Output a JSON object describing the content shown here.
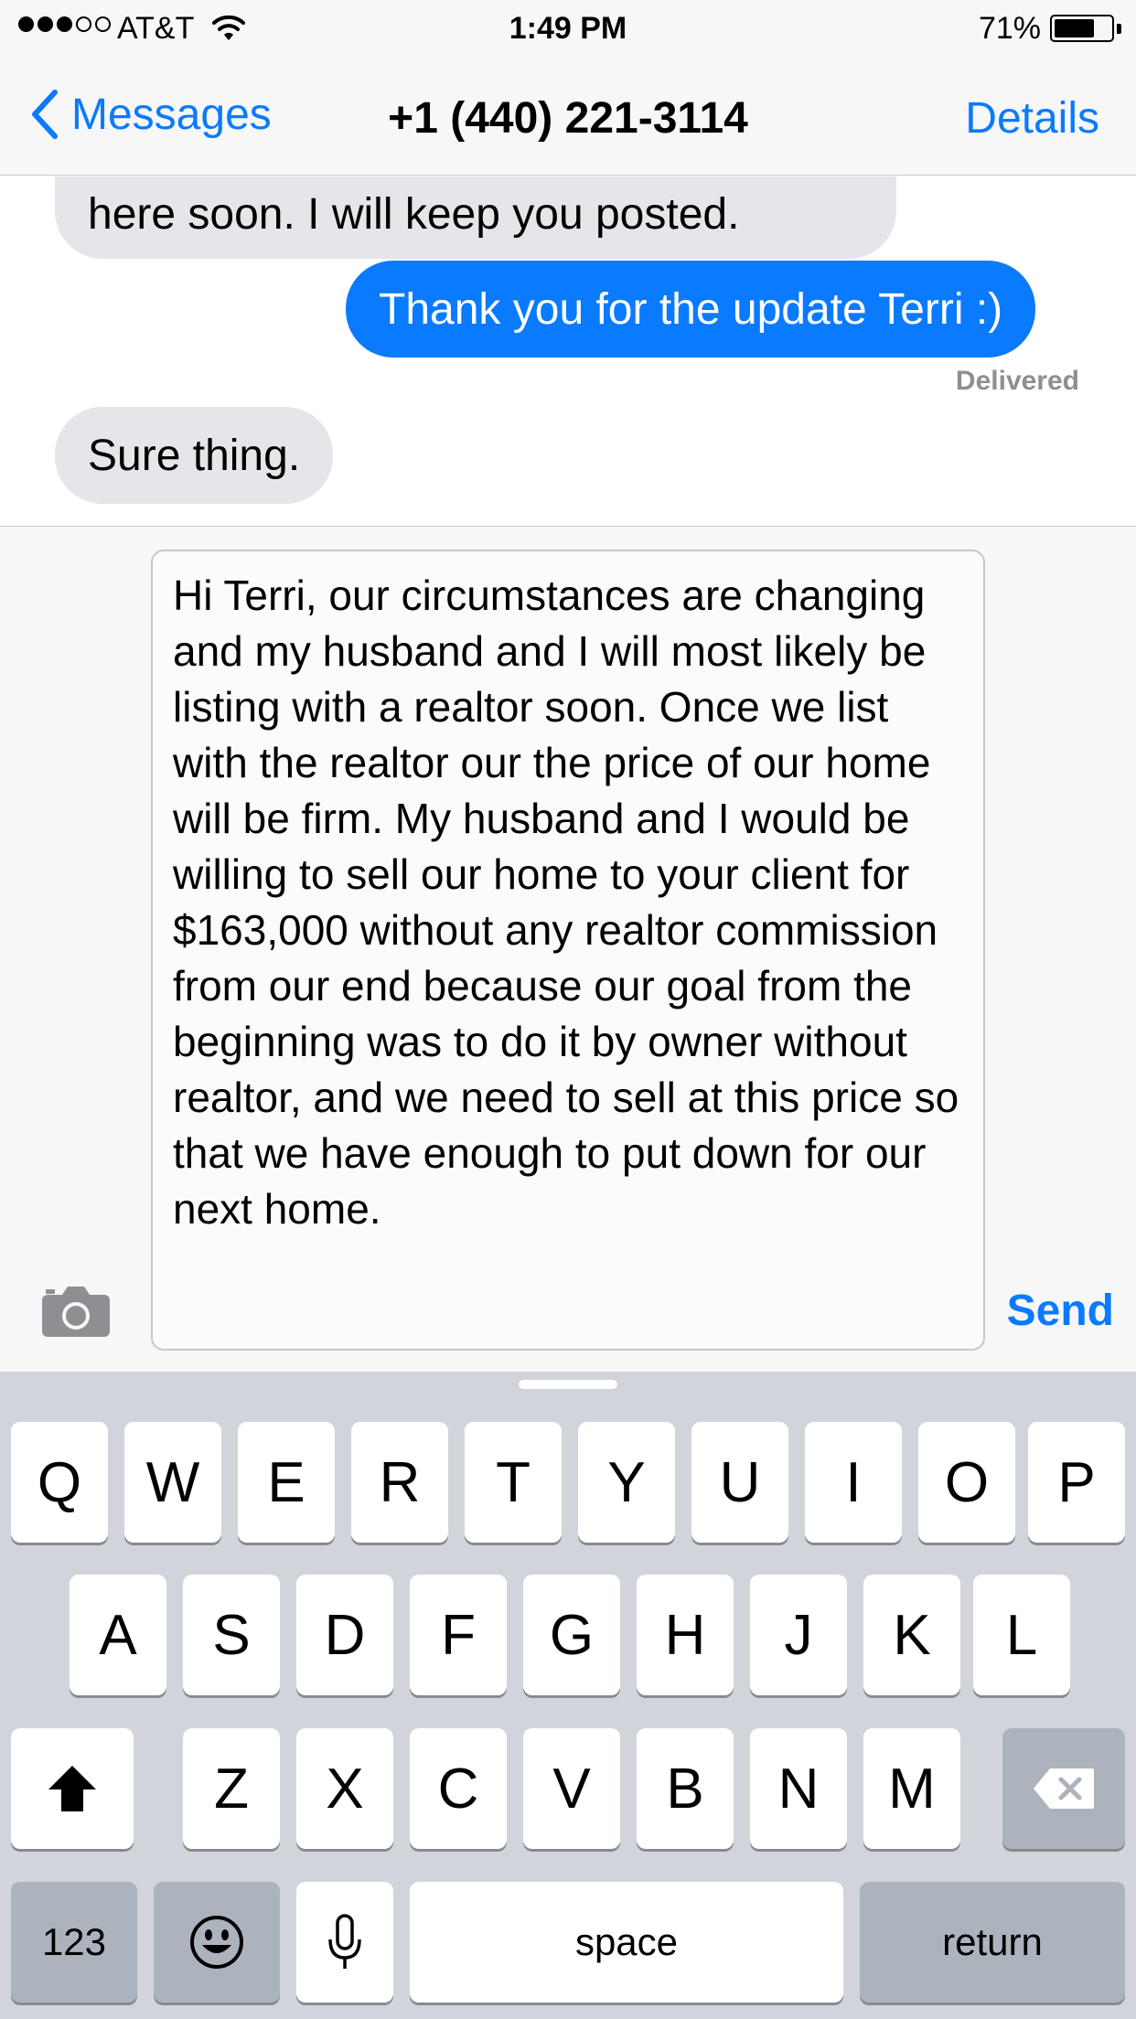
{
  "status_bar": {
    "signal_dots": 5,
    "signal_filled": 3,
    "carrier": "AT&T",
    "time": "1:49 PM",
    "battery_percent_label": "71%",
    "battery_level": 0.71
  },
  "nav": {
    "back_label": "Messages",
    "title": "+1 (440) 221-3114",
    "details_label": "Details"
  },
  "messages": [
    {
      "direction": "incoming",
      "text": "here soon. I will keep you posted."
    },
    {
      "direction": "outgoing",
      "text": "Thank you for the update Terri :)"
    },
    {
      "direction": "incoming",
      "text": "Sure thing."
    }
  ],
  "delivery_status": "Delivered",
  "compose": {
    "text": "Hi Terri, our circumstances are changing and my husband and I will most likely be listing with a realtor soon. Once we list with the realtor our the price of our home will be firm. My husband and I would be willing to sell our home to your client for $163,000 without any realtor commission from our end because our goal from the beginning was to do it by owner without realtor, and we need to sell at this price so that we have enough to put down for our next home.",
    "send_label": "Send"
  },
  "keyboard": {
    "row1": [
      "Q",
      "W",
      "E",
      "R",
      "T",
      "Y",
      "U",
      "I",
      "O",
      "P"
    ],
    "row2": [
      "A",
      "S",
      "D",
      "F",
      "G",
      "H",
      "J",
      "K",
      "L"
    ],
    "row3": [
      "Z",
      "X",
      "C",
      "V",
      "B",
      "N",
      "M"
    ],
    "numbers_label": "123",
    "space_label": "space",
    "return_label": "return"
  },
  "colors": {
    "accent": "#0a7aff",
    "outgoing_bubble": "#0a7aff",
    "incoming_bubble": "#e5e5ea",
    "keyboard_bg": "#d1d5db",
    "special_key": "#acb3bd"
  },
  "icons": [
    "signal-dots",
    "wifi-icon",
    "battery-icon",
    "chevron-left-icon",
    "camera-icon",
    "shift-icon",
    "delete-icon",
    "emoji-icon",
    "microphone-icon"
  ]
}
